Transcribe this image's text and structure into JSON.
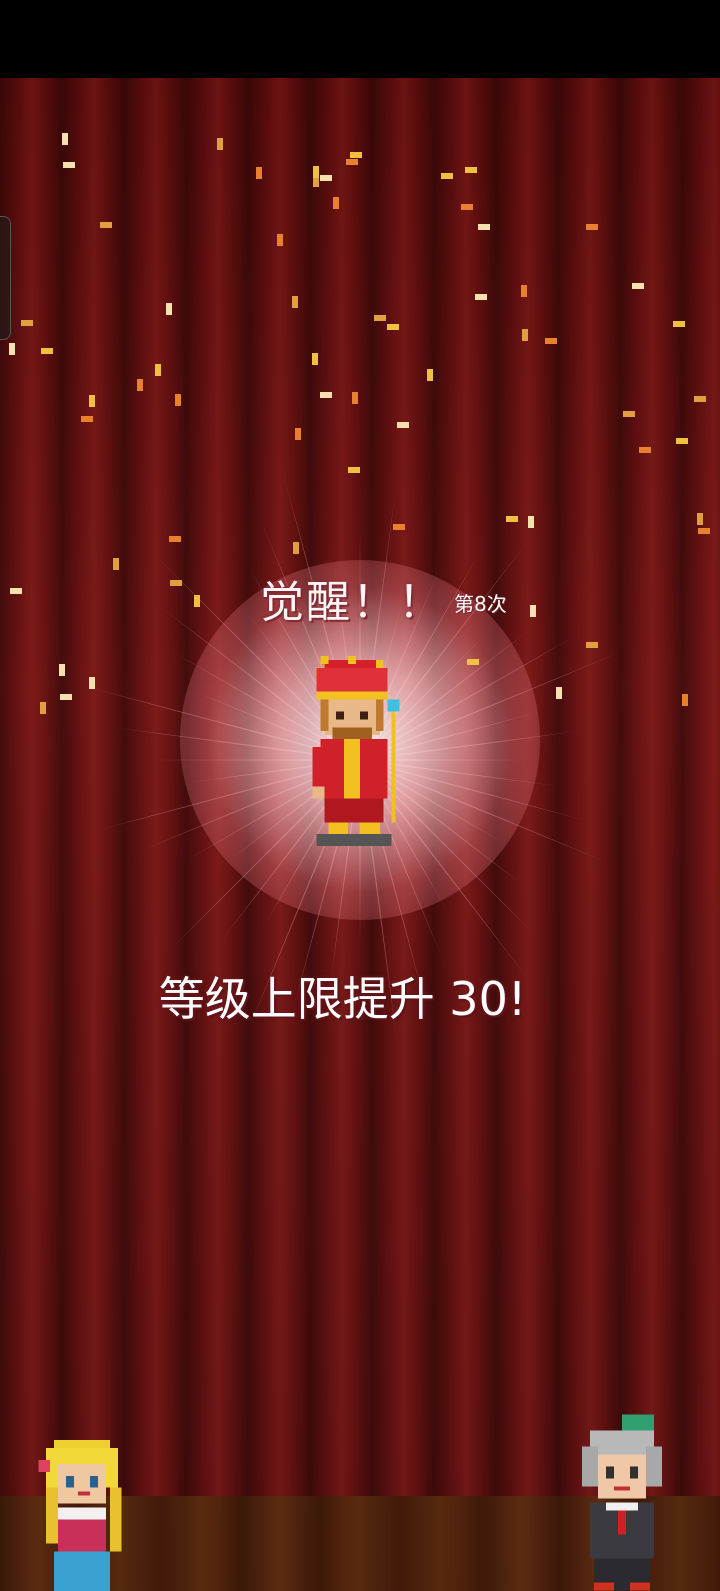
{
  "awakening": {
    "title": "觉醒！！",
    "count_label": "第8次",
    "level_message": "等级上限提升 30!"
  },
  "colors": {
    "curtain": "#6e1414",
    "glow": "#ffd0d5",
    "text": "#ffffff",
    "confetti": [
      "#f0c040",
      "#e88030",
      "#f5e0b0",
      "#e0a040"
    ]
  },
  "characters": {
    "hero": "crowned-king-sprite",
    "left": "blonde-girl-sprite",
    "right": "gray-haired-boy-sprite"
  }
}
